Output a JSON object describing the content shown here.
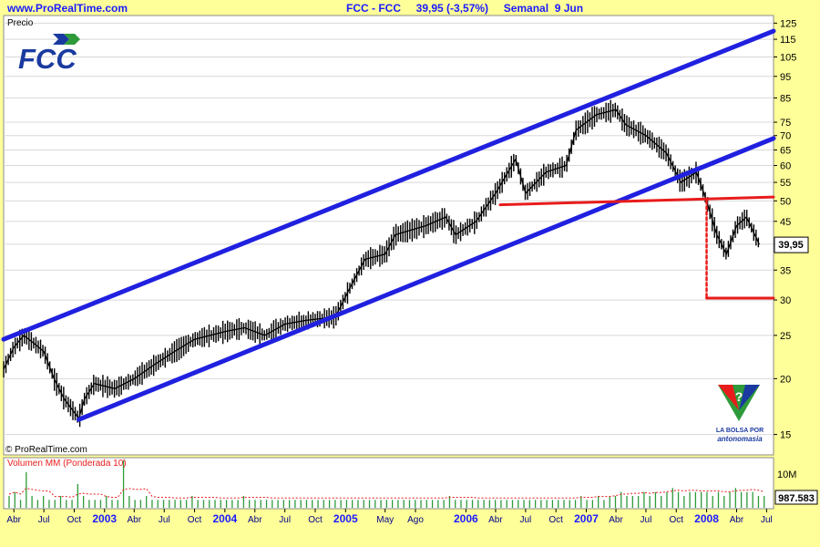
{
  "header": {
    "site": "www.ProRealTime.com",
    "title": "FCC - FCC     39,95 (-3,57%)     Semanal  9 Jun"
  },
  "main_panel": {
    "label": "Precio",
    "copyright": "© ProRealTime.com",
    "logo": {
      "text": "FCC",
      "icon": "fcc-logo",
      "colors": [
        "#1a3aa0",
        "#2e9a3a"
      ]
    },
    "watermark": {
      "line1": "LA BOLSA POR",
      "line2": "antonomasia",
      "icon": "question-shield-icon"
    },
    "price_tag": "39,95"
  },
  "volume_panel": {
    "label": "Volumen MM (Ponderada 10)",
    "tick_label": "10M",
    "value_tag": "987.583"
  },
  "chart_data": {
    "type": "line",
    "y_scale": "log",
    "ylim": [
      13.5,
      130
    ],
    "yticks": [
      15,
      20,
      25,
      30,
      35,
      40,
      45,
      50,
      55,
      60,
      65,
      70,
      75,
      85,
      95,
      105,
      115,
      125
    ],
    "x_months": [
      "Abr",
      "Jul",
      "Oct",
      "2003",
      "Abr",
      "Jul",
      "Oct",
      "2004",
      "Abr",
      "Jul",
      "Oct",
      "2005",
      "May",
      "Ago",
      "2006",
      "Abr",
      "Jul",
      "Oct",
      "2007",
      "Abr",
      "Jul",
      "Oct",
      "2008",
      "Abr",
      "Jul"
    ],
    "x_years": [
      "2003",
      "2004",
      "2005",
      "2006",
      "2007",
      "2008"
    ],
    "x_range": [
      "2002-03-01",
      "2008-07-22"
    ],
    "series": [
      {
        "values": [
          [
            "2002-03-01",
            21
          ],
          [
            "2002-04-01",
            23.5
          ],
          [
            "2002-05-01",
            25
          ],
          [
            "2002-06-01",
            24
          ],
          [
            "2002-07-01",
            23
          ],
          [
            "2002-08-01",
            20
          ],
          [
            "2002-09-01",
            18
          ],
          [
            "2002-10-15",
            16.3
          ],
          [
            "2002-11-01",
            18
          ],
          [
            "2002-12-01",
            19.5
          ],
          [
            "2003-02-01",
            19
          ],
          [
            "2003-04-01",
            20
          ],
          [
            "2003-06-01",
            21.5
          ],
          [
            "2003-08-01",
            23
          ],
          [
            "2003-10-01",
            24.5
          ],
          [
            "2004-01-01",
            25.5
          ],
          [
            "2004-03-01",
            26
          ],
          [
            "2004-05-01",
            25
          ],
          [
            "2004-07-01",
            26.5
          ],
          [
            "2004-09-01",
            27
          ],
          [
            "2004-12-01",
            27.5
          ],
          [
            "2005-01-15",
            32
          ],
          [
            "2005-03-01",
            37
          ],
          [
            "2005-05-01",
            38
          ],
          [
            "2005-06-01",
            42
          ],
          [
            "2005-09-01",
            44
          ],
          [
            "2005-11-01",
            46
          ],
          [
            "2005-12-01",
            42
          ],
          [
            "2006-02-01",
            45
          ],
          [
            "2006-04-01",
            52
          ],
          [
            "2006-06-01",
            62
          ],
          [
            "2006-07-01",
            52
          ],
          [
            "2006-09-01",
            58
          ],
          [
            "2006-11-01",
            60
          ],
          [
            "2006-12-01",
            72
          ],
          [
            "2007-02-01",
            78
          ],
          [
            "2007-04-01",
            80
          ],
          [
            "2007-05-01",
            74
          ],
          [
            "2007-07-01",
            70
          ],
          [
            "2007-09-01",
            64
          ],
          [
            "2007-10-15",
            55
          ],
          [
            "2007-12-01",
            58
          ],
          [
            "2008-01-01",
            50
          ],
          [
            "2008-02-01",
            42
          ],
          [
            "2008-03-01",
            38
          ],
          [
            "2008-04-01",
            44
          ],
          [
            "2008-05-01",
            46
          ],
          [
            "2008-06-09",
            39.95
          ]
        ]
      }
    ],
    "lines": [
      {
        "from": [
          "2002-03-01",
          24.5
        ],
        "to": [
          "2008-07-22",
          120
        ],
        "color": "#2020e0"
      },
      {
        "from": [
          "2002-10-15",
          16.2
        ],
        "to": [
          "2008-07-22",
          69
        ],
        "color": "#2020e0"
      },
      {
        "from": [
          "2006-04-15",
          49
        ],
        "to": [
          "2008-07-22",
          51
        ],
        "color": "#e81c1c"
      },
      {
        "from": [
          "2008-01-01",
          30.3
        ],
        "to": [
          "2008-07-22",
          30.3
        ],
        "color": "#e81c1c"
      },
      {
        "from": [
          "2008-01-01",
          50
        ],
        "to": [
          "2008-01-01",
          30.3
        ],
        "color": "#e81c1c",
        "dashed": true
      }
    ],
    "volume_values": [
      3,
      4,
      2,
      9,
      3,
      2,
      3,
      2,
      2,
      3,
      2,
      2,
      6,
      3,
      2,
      2,
      2,
      3,
      2,
      2,
      12,
      3,
      2,
      2,
      3,
      2,
      2,
      2,
      2,
      2,
      2,
      2,
      3,
      2,
      2,
      2,
      2,
      2,
      2,
      2,
      2,
      3,
      2,
      2,
      2,
      2,
      2,
      2,
      2,
      2,
      2,
      2,
      2,
      2,
      2,
      2,
      2,
      2,
      2,
      2,
      2,
      2,
      2,
      2,
      2,
      2,
      2,
      2,
      2,
      2,
      2,
      2,
      2,
      2,
      2,
      2,
      2,
      3,
      2,
      2,
      2,
      2,
      2,
      2,
      2,
      2,
      2,
      2,
      2,
      2,
      2,
      2,
      2,
      2,
      2,
      2,
      2,
      2,
      2,
      2,
      3,
      2,
      2,
      3,
      2,
      3,
      3,
      4,
      3,
      3,
      3,
      4,
      3,
      4,
      3,
      4,
      5,
      4,
      3,
      4,
      4,
      4,
      4,
      3,
      4,
      3,
      4,
      5,
      4,
      4,
      4,
      3,
      3
    ]
  }
}
